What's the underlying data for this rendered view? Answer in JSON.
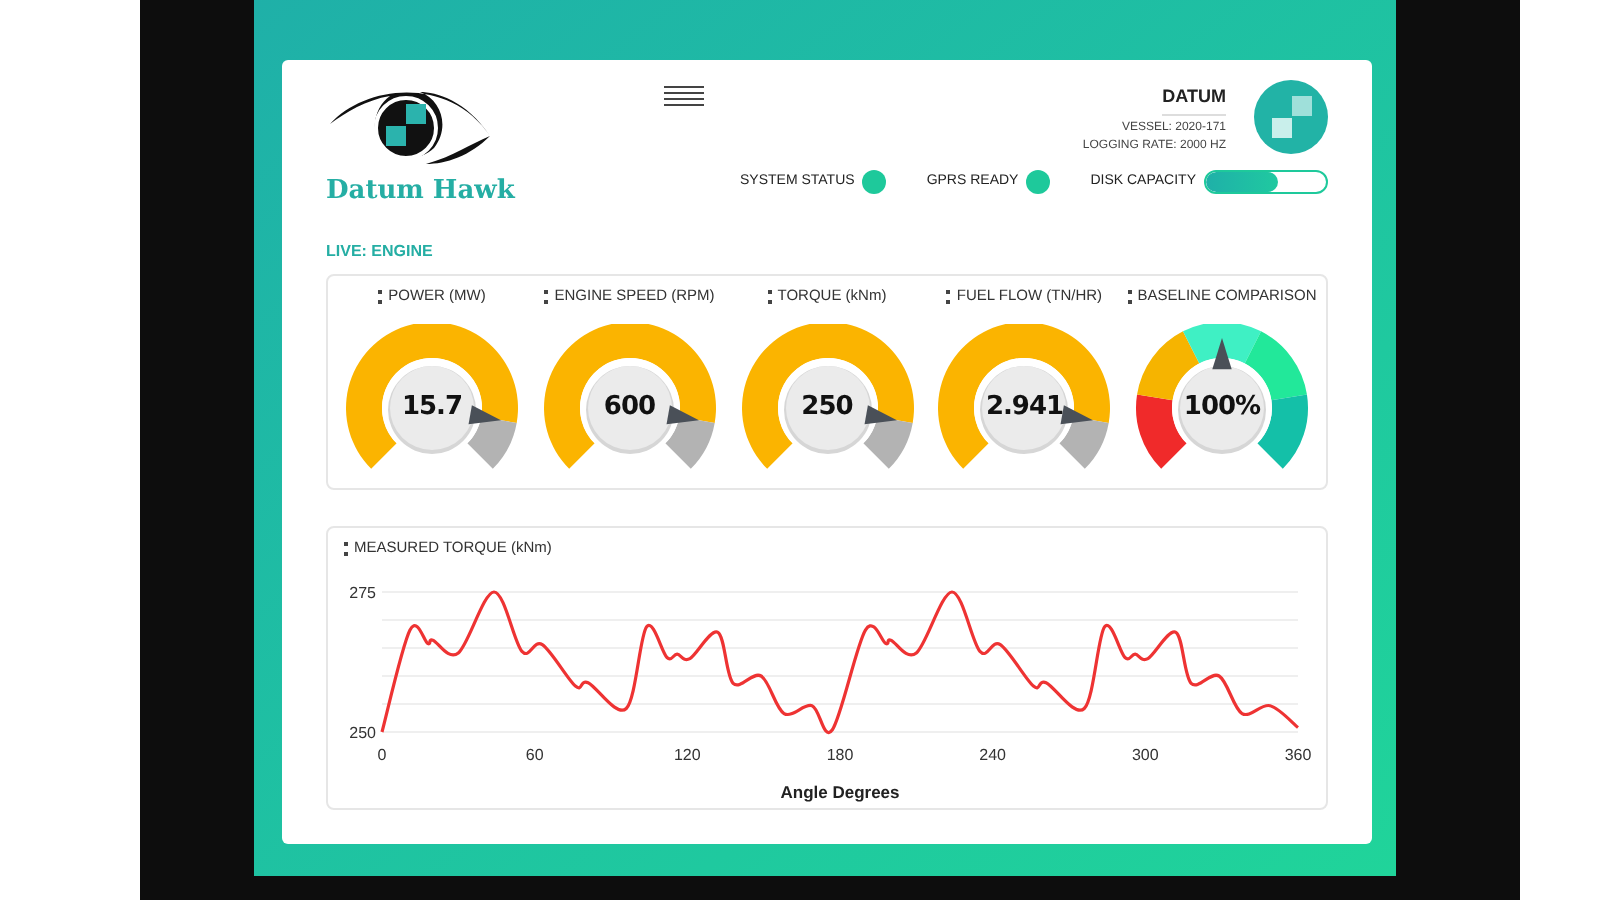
{
  "brand": {
    "name": "Datum Hawk"
  },
  "account": {
    "name": "DATUM",
    "vessel": "VESSEL: 2020-171",
    "logging_rate": "LOGGING RATE: 2000 HZ"
  },
  "status": [
    {
      "label": "SYSTEM STATUS",
      "kind": "dot",
      "on": true
    },
    {
      "label": "GPRS READY",
      "kind": "dot",
      "on": true
    },
    {
      "label": "DISK CAPACITY",
      "kind": "bar",
      "level": 0.6
    }
  ],
  "section_label": "LIVE: ENGINE",
  "gauges": [
    {
      "title": "POWER (MW)",
      "value": "15.7",
      "kind": "single"
    },
    {
      "title": "ENGINE SPEED (RPM)",
      "value": "600",
      "kind": "single"
    },
    {
      "title": "TORQUE (kNm)",
      "value": "250",
      "kind": "single"
    },
    {
      "title": "FUEL FLOW (TN/HR)",
      "value": "2.941",
      "kind": "single"
    },
    {
      "title": "BASELINE COMPARISON",
      "value": "100%",
      "kind": "zones"
    }
  ],
  "torque_panel": {
    "title": "MEASURED TORQUE (kNm)",
    "chart_data": {
      "type": "line",
      "xlabel": "Angle Degrees",
      "x": [
        0,
        11,
        18,
        20,
        30,
        44,
        55,
        63,
        76,
        81,
        96,
        104,
        112,
        116,
        121,
        132,
        138,
        149,
        158,
        169,
        177,
        190,
        198,
        200,
        210,
        224,
        235,
        243,
        256,
        261,
        276,
        284,
        292,
        296,
        301,
        312,
        318,
        329,
        338,
        349,
        360
      ],
      "series": [
        {
          "color": "#ee3333",
          "values": [
            250,
            268.2,
            265.8,
            266.4,
            264.1,
            275,
            264.4,
            265.6,
            258.2,
            258.8,
            254.2,
            268.8,
            263.3,
            263.9,
            263.1,
            267.8,
            258.7,
            260,
            253.3,
            254.7,
            250.4,
            268.2,
            265.8,
            266.4,
            264.1,
            275,
            264.4,
            265.6,
            258.2,
            258.8,
            254.2,
            268.8,
            263.3,
            263.9,
            263.1,
            267.8,
            258.7,
            260,
            253.3,
            254.7,
            250.8
          ]
        }
      ],
      "xlim": [
        0,
        360
      ],
      "ylim": [
        250,
        275
      ],
      "xticks": [
        0,
        60,
        120,
        180,
        240,
        300,
        360
      ],
      "yticks": [
        250,
        275
      ]
    }
  }
}
